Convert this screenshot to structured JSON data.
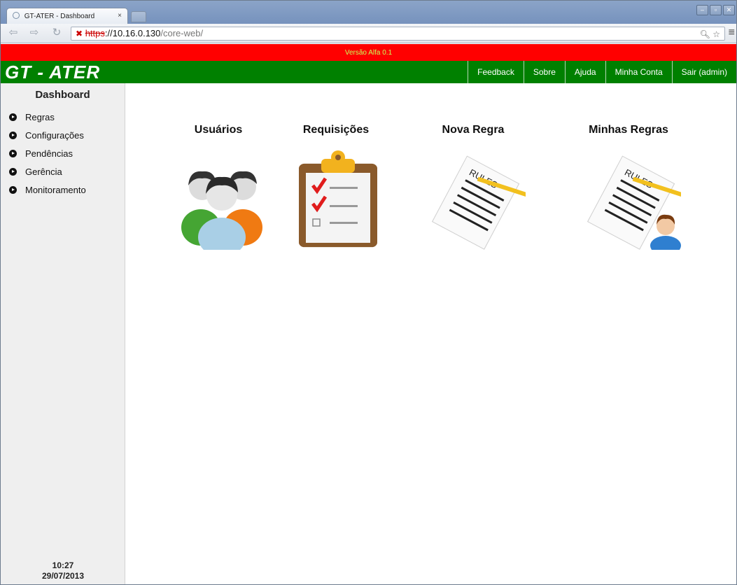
{
  "browser": {
    "tab_title": "GT-ATER - Dashboard",
    "tab_close": "×",
    "url_scheme": "https",
    "url_host": "://10.16.0.130",
    "url_path": "/core-web/"
  },
  "page": {
    "version_text": "Versão Alfa 0.1",
    "logo": "GT - ATER",
    "nav": [
      "Feedback",
      "Sobre",
      "Ajuda",
      "Minha Conta",
      "Sair (admin)"
    ]
  },
  "sidebar": {
    "title": "Dashboard",
    "items": [
      "Regras",
      "Configurações",
      "Pendências",
      "Gerência",
      "Monitoramento"
    ],
    "time": "10:27",
    "date": "29/07/2013"
  },
  "tiles": [
    {
      "label": "Usuários",
      "icon": "users-group-icon"
    },
    {
      "label": "Requisições",
      "icon": "clipboard-checklist-icon"
    },
    {
      "label": "Nova Regra",
      "icon": "rules-document-pencil-icon"
    },
    {
      "label": "Minhas Regras",
      "icon": "rules-document-user-icon"
    }
  ],
  "rules_text": "RULES"
}
